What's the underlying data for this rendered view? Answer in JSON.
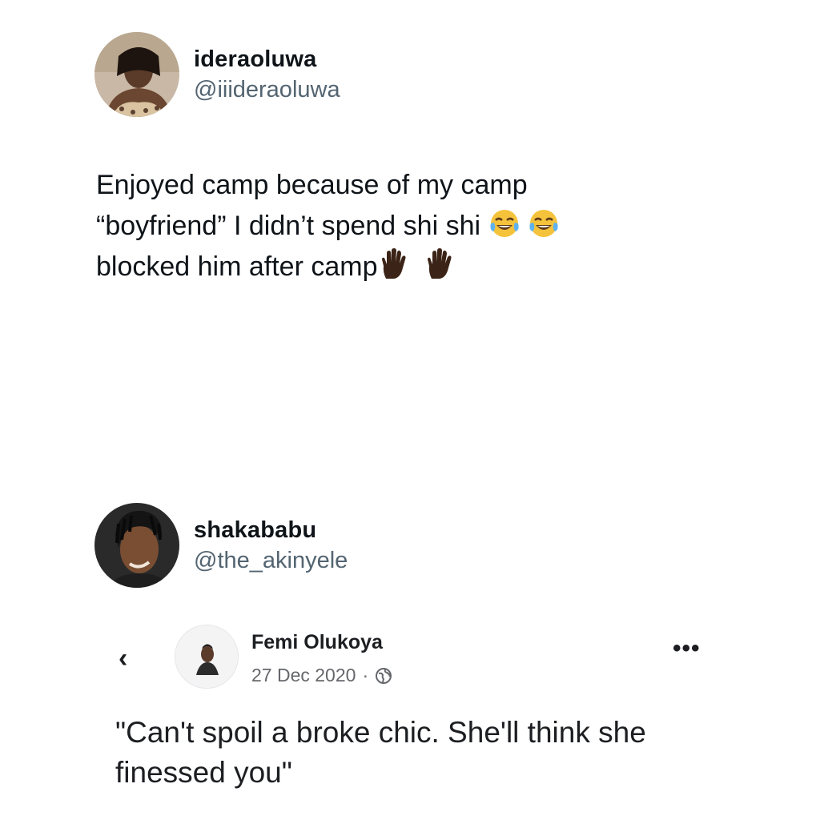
{
  "tweet1": {
    "display_name": "ideraoluwa",
    "handle": "@iiideraoluwa",
    "text_line1": "Enjoyed camp because of my camp",
    "text_line2": "“boyfriend” I didn’t spend shi shi",
    "text_line3": "blocked him after camp",
    "emojis_line2": [
      "face-with-tears-of-joy-icon",
      "face-with-tears-of-joy-icon"
    ],
    "emojis_line3": [
      "raised-hand-icon",
      "raised-hand-icon"
    ]
  },
  "tweet2": {
    "display_name": "shakababu",
    "handle": "@the_akinyele",
    "embedded_post": {
      "author": "Femi Olukoya",
      "date": "27 Dec 2020",
      "separator": "·",
      "privacy_icon": "globe-icon",
      "back_glyph": "‹",
      "more_glyph": "•••",
      "text": "\"Can't spoil a broke chic. She'll think she finessed you\""
    }
  },
  "colors": {
    "text": "#0f1419",
    "handle_gray": "#536471",
    "fb_text": "#1c1e21",
    "fb_meta": "#65676b"
  }
}
